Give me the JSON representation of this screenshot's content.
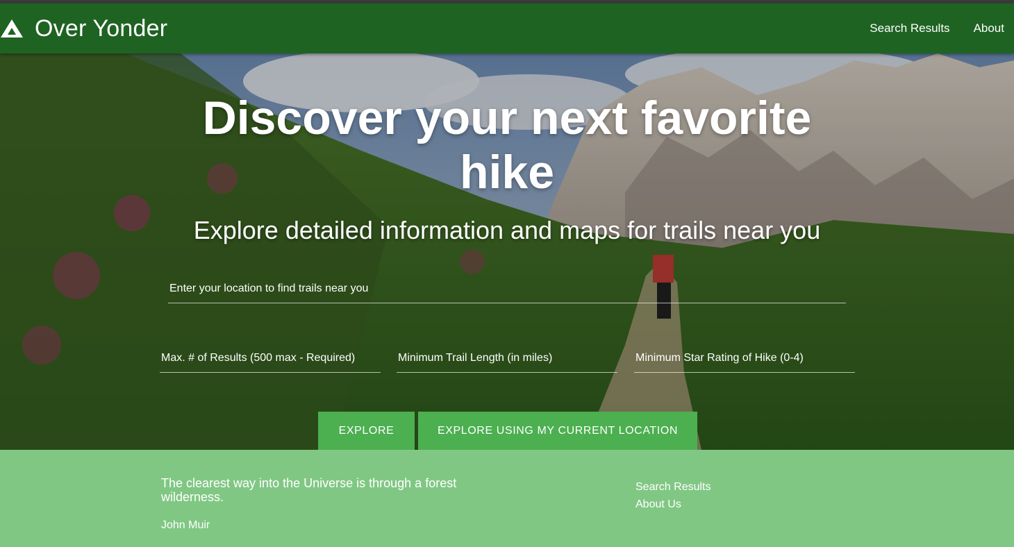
{
  "header": {
    "brand_name": "Over Yonder",
    "brand_icon": "mountain-icon",
    "nav": [
      "Search Results",
      "About"
    ]
  },
  "hero": {
    "headline_line1": "Discover your next favorite",
    "headline_line2": "hike",
    "subheadline": "Explore detailed information and maps for trails near you",
    "location_placeholder": "Enter your location to find trails near you",
    "max_results_placeholder": "Max. # of Results (500 max - Required)",
    "min_length_placeholder": "Minimum Trail Length (in miles)",
    "min_rating_placeholder": "Minimum Star Rating of Hike (0-4)",
    "explore_label": "EXPLORE",
    "explore_current_label": "EXPLORE USING MY CURRENT LOCATION"
  },
  "footer": {
    "quote": "The clearest way into the Universe is through a forest wilderness.",
    "author": "John Muir",
    "links": [
      "Search Results",
      "About Us"
    ]
  },
  "colors": {
    "navbar": "#1f6322",
    "button": "#4caf50",
    "footer": "#81c784"
  }
}
